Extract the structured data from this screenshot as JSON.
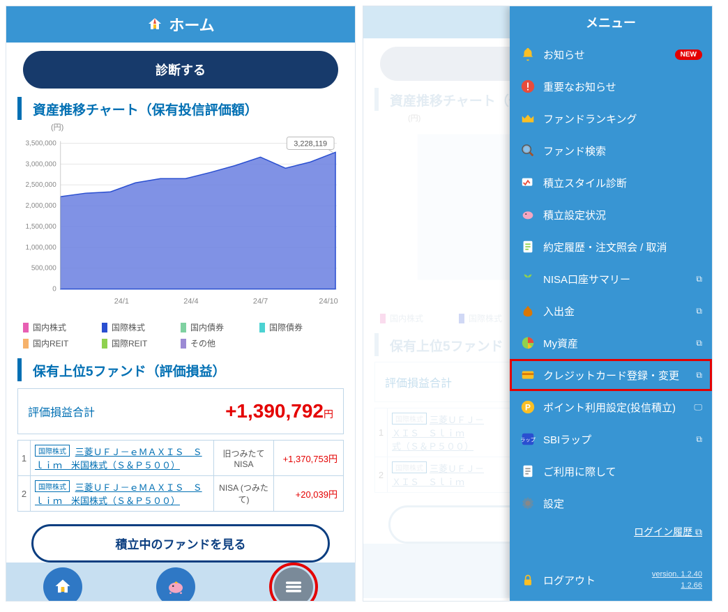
{
  "header": {
    "title": "ホーム",
    "diagnose": "診断する"
  },
  "chart": {
    "section_title": "資産推移チャート（保有投信評価額）",
    "y_unit": "(円)",
    "callout": "3,228,119"
  },
  "legend": {
    "items": [
      {
        "label": "国内株式",
        "color": "#e75fb3"
      },
      {
        "label": "国際株式",
        "color": "#2a4fd0"
      },
      {
        "label": "国内債券",
        "color": "#7fd1a1"
      },
      {
        "label": "国際債券",
        "color": "#4cd2d2"
      },
      {
        "label": "国内REIT",
        "color": "#f6b26b"
      },
      {
        "label": "国際REIT",
        "color": "#8fd14f"
      },
      {
        "label": "その他",
        "color": "#9b8ad4"
      }
    ]
  },
  "top5": {
    "section_title": "保有上位5ファンド（評価損益）",
    "total_label": "評価損益合計",
    "total_value": "+1,390,792",
    "yen": "円",
    "rows": [
      {
        "rank": "1",
        "tag": "国際株式",
        "name": "三菱ＵＦＪ－ｅＭＡＸＩＳ　Ｓｌｉｍ　米国株式（Ｓ＆Ｐ５００）",
        "type": "旧つみたてNISA",
        "pl": "+1,370,753円"
      },
      {
        "rank": "2",
        "tag": "国際株式",
        "name": "三菱ＵＦＪ－ｅＭＡＸＩＳ　Ｓｌｉｍ　米国株式（Ｓ＆Ｐ５００）",
        "type": "NISA (つみたて)",
        "pl": "+20,039円"
      }
    ],
    "view_btn": "積立中のファンドを見る"
  },
  "menu": {
    "title": "メニュー",
    "login_history": "ログイン履歴",
    "logout": "ログアウト",
    "version1": "version. 1.2.40",
    "version2": "1.2.66",
    "items": [
      {
        "label": "お知らせ",
        "new": "NEW"
      },
      {
        "label": "重要なお知らせ"
      },
      {
        "label": "ファンドランキング"
      },
      {
        "label": "ファンド検索"
      },
      {
        "label": "積立スタイル診断"
      },
      {
        "label": "積立設定状況"
      },
      {
        "label": "約定履歴・注文照会 / 取消"
      },
      {
        "label": "NISA口座サマリー",
        "ext": true
      },
      {
        "label": "入出金",
        "ext": true
      },
      {
        "label": "My資産",
        "ext": true
      },
      {
        "label": "クレジットカード登録・変更",
        "ext": true,
        "selected": true
      },
      {
        "label": "ポイント利用設定(投信積立)",
        "monitor": true
      },
      {
        "label": "SBIラップ",
        "ext": true
      },
      {
        "label": "ご利用に際して"
      },
      {
        "label": "設定"
      }
    ]
  },
  "chart_data": {
    "type": "area",
    "title": "資産推移チャート（保有投信評価額）",
    "xlabel": "",
    "ylabel": "(円)",
    "ylim": [
      0,
      3500000
    ],
    "y_ticks": [
      0,
      500000,
      1000000,
      1500000,
      2000000,
      2500000,
      3000000,
      3500000
    ],
    "x_ticks": [
      "24/1",
      "24/4",
      "24/7",
      "24/10"
    ],
    "callout_value": 3228119,
    "series": [
      {
        "name": "国際株式",
        "color": "#2a4fd0",
        "x": [
          "23/11",
          "23/12",
          "24/1",
          "24/2",
          "24/3",
          "24/4",
          "24/5",
          "24/6",
          "24/7",
          "24/8",
          "24/9",
          "24/10"
        ],
        "values": [
          2200000,
          2250000,
          2280000,
          2500000,
          2600000,
          2600000,
          2750000,
          2900000,
          3100000,
          2850000,
          3000000,
          3228119
        ]
      }
    ],
    "legend": [
      "国内株式",
      "国際株式",
      "国内債券",
      "国際債券",
      "国内REIT",
      "国際REIT",
      "その他"
    ]
  }
}
